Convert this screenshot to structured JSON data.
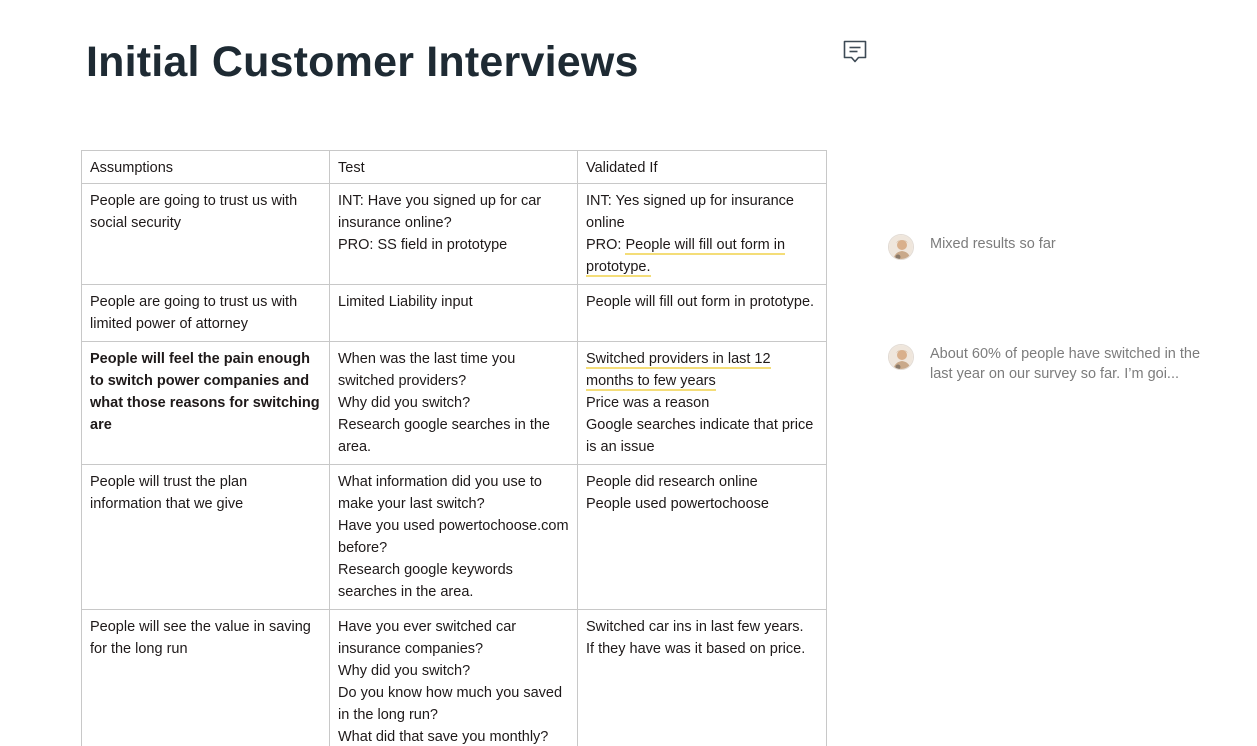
{
  "document": {
    "title": "Initial Customer Interviews"
  },
  "table": {
    "headers": [
      "Assumptions",
      "Test",
      "Validated If"
    ],
    "rows": [
      {
        "assumption": [
          "People are going to trust us with social security"
        ],
        "test": [
          "INT: Have you signed up for car insurance online?",
          "PRO: SS field in prototype"
        ],
        "validated_plain": "INT: Yes signed up for insurance online",
        "validated_prefix": "PRO: ",
        "validated_highlight": "People will fill out form in prototype."
      },
      {
        "assumption": [
          "People are going to trust us with limited power of attorney"
        ],
        "test": [
          "Limited Liability input"
        ],
        "validated": [
          "People will fill out form in prototype."
        ]
      },
      {
        "assumption_bold": "People will feel the pain enough to switch power companies and what those reasons for switching are",
        "test": [
          "When was the last time you switched providers?",
          "Why did you switch?",
          "Research google searches in the area."
        ],
        "validated_highlight": "Switched providers in last 12 months to few years",
        "validated": [
          "Price was a reason",
          "Google searches indicate that price is an issue"
        ]
      },
      {
        "assumption": [
          "People will trust the plan information that we give"
        ],
        "test": [
          "What information did you use to make your last switch?",
          "Have you used powertochoose.com before?",
          "Research google keywords searches in the area."
        ],
        "validated": [
          "People did research online",
          "People used powertochoose"
        ]
      },
      {
        "assumption": [
          "People will see the value in saving for the long run"
        ],
        "test": [
          "Have you ever switched car insurance companies?",
          "Why did you switch?",
          "Do you know how much you saved in the long run?",
          "What did that save you monthly?"
        ],
        "validated": [
          "Switched car ins in last few years.",
          "If they have was it based on price."
        ]
      }
    ]
  },
  "comments": [
    {
      "text": "Mixed results so far"
    },
    {
      "text": "About 60% of people have switched in the last year on our survey so far. I’m goi..."
    }
  ],
  "icons": {
    "comment_button": "comment-icon",
    "avatar": "user-avatar"
  },
  "colors": {
    "highlight_underline": "#f4dd78",
    "title": "#1e2a33",
    "comment_text": "#7c7c7c",
    "table_border": "#c8c8c8"
  }
}
